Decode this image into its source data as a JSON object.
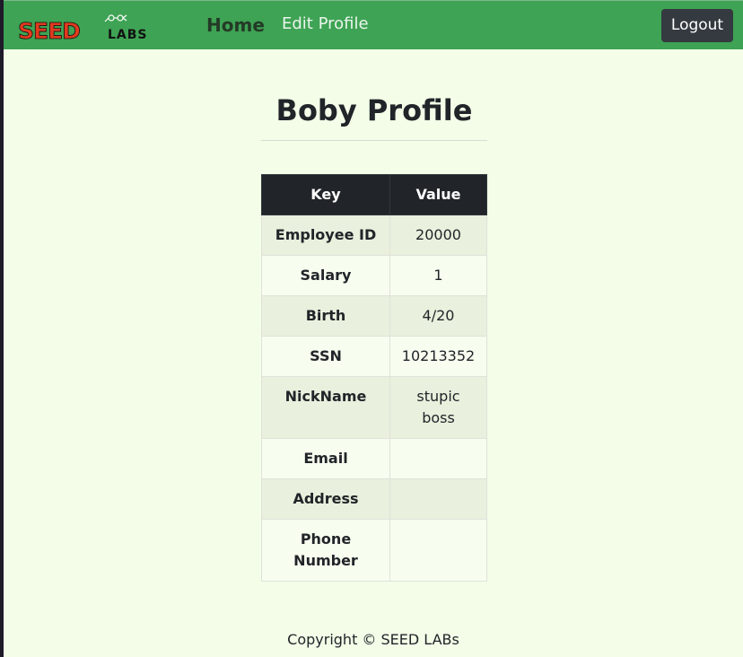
{
  "nav": {
    "logo_text": "SEED LABS",
    "home_label": "Home",
    "edit_profile_label": "Edit Profile",
    "logout_label": "Logout"
  },
  "profile": {
    "title": "Boby Profile",
    "table": {
      "headers": [
        "Key",
        "Value"
      ],
      "rows": [
        {
          "key": "Employee ID",
          "value": "20000"
        },
        {
          "key": "Salary",
          "value": "1"
        },
        {
          "key": "Birth",
          "value": "4/20"
        },
        {
          "key": "SSN",
          "value": "10213352"
        },
        {
          "key": "NickName",
          "value": "stupic boss"
        },
        {
          "key": "Email",
          "value": ""
        },
        {
          "key": "Address",
          "value": ""
        },
        {
          "key": "Phone Number",
          "value": ""
        }
      ]
    }
  },
  "footer": {
    "copyright": "Copyright © SEED LABs"
  },
  "colors": {
    "navbar": "#3ea354",
    "page_background": "#f3fde8",
    "table_header": "#212529",
    "logout_button": "#343a40",
    "logo_red": "#e03a1e"
  }
}
